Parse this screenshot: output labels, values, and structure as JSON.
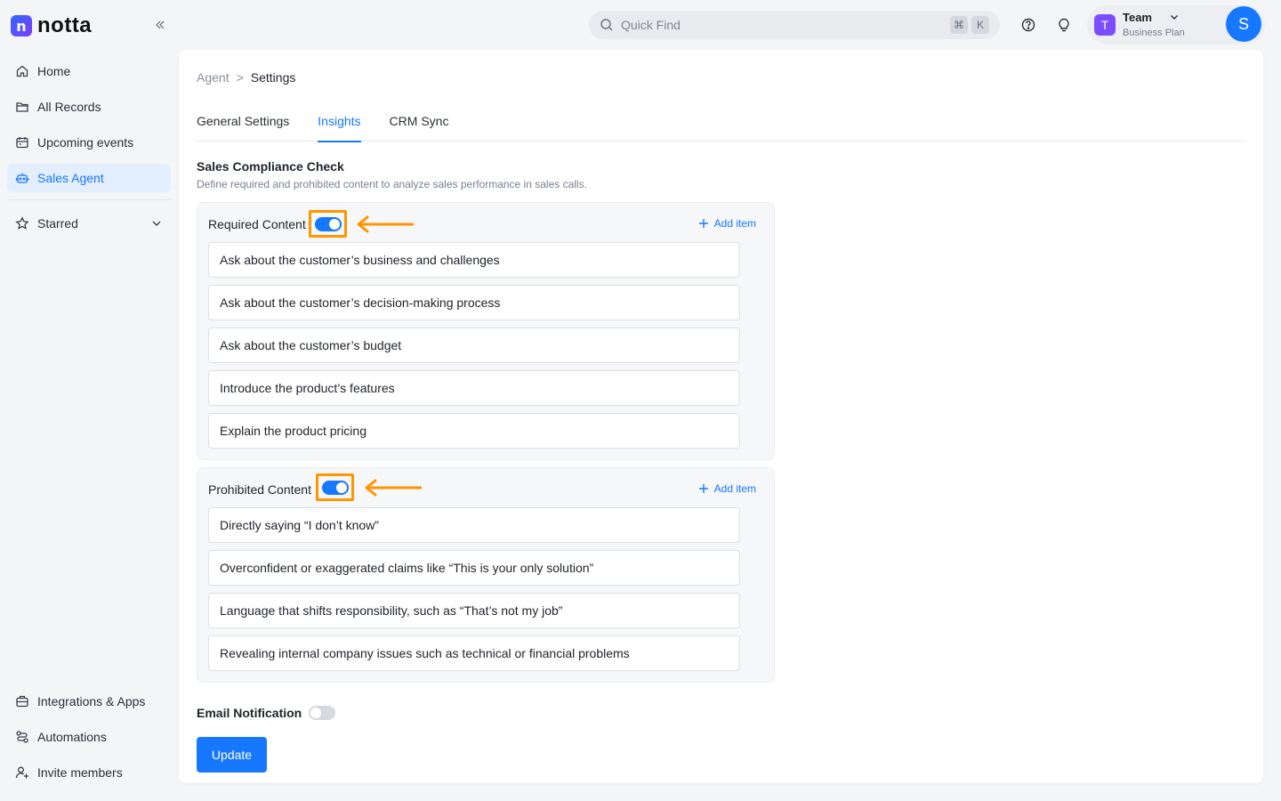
{
  "app": {
    "name": "notta",
    "logo_letter": "n"
  },
  "sidebar": {
    "items": [
      {
        "label": "Home",
        "icon": "home-icon"
      },
      {
        "label": "All Records",
        "icon": "folder-icon"
      },
      {
        "label": "Upcoming events",
        "icon": "calendar-icon"
      },
      {
        "label": "Sales Agent",
        "icon": "robot-icon",
        "active": true
      },
      {
        "label": "Starred",
        "icon": "star-icon"
      }
    ],
    "bottom_items": [
      {
        "label": "Integrations & Apps",
        "icon": "briefcase-icon"
      },
      {
        "label": "Automations",
        "icon": "automation-icon"
      },
      {
        "label": "Invite members",
        "icon": "add-user-icon"
      }
    ]
  },
  "topbar": {
    "search_placeholder": "Quick Find",
    "shortcut_keys": [
      "⌘",
      "K"
    ],
    "team": {
      "badge": "T",
      "name": "Team",
      "plan": "Business Plan"
    },
    "avatar_letter": "S"
  },
  "breadcrumb": {
    "parent": "Agent",
    "separator": ">",
    "current": "Settings"
  },
  "tabs": [
    {
      "label": "General Settings"
    },
    {
      "label": "Insights",
      "active": true
    },
    {
      "label": "CRM Sync"
    }
  ],
  "section": {
    "title": "Sales Compliance Check",
    "description": "Define required and prohibited content to analyze sales performance in sales calls."
  },
  "required": {
    "label": "Required Content",
    "enabled": true,
    "add_label": "Add item",
    "items": [
      "Ask about the customer’s business and challenges",
      "Ask about the customer’s decision-making process",
      "Ask about the customer’s budget",
      "Introduce the product’s features",
      "Explain the product pricing"
    ]
  },
  "prohibited": {
    "label": "Prohibited Content",
    "enabled": true,
    "add_label": "Add item",
    "items": [
      "Directly saying “I don’t know”",
      "Overconfident or exaggerated claims like “This is your only solution”",
      "Language that shifts responsibility, such as “That’s not my job”",
      "Revealing internal company issues such as technical or financial problems"
    ]
  },
  "email_notification": {
    "label": "Email Notification",
    "enabled": false
  },
  "update_label": "Update",
  "colors": {
    "accent": "#1677ff",
    "highlight": "#ff9500",
    "team_badge": "#7b4dff"
  }
}
